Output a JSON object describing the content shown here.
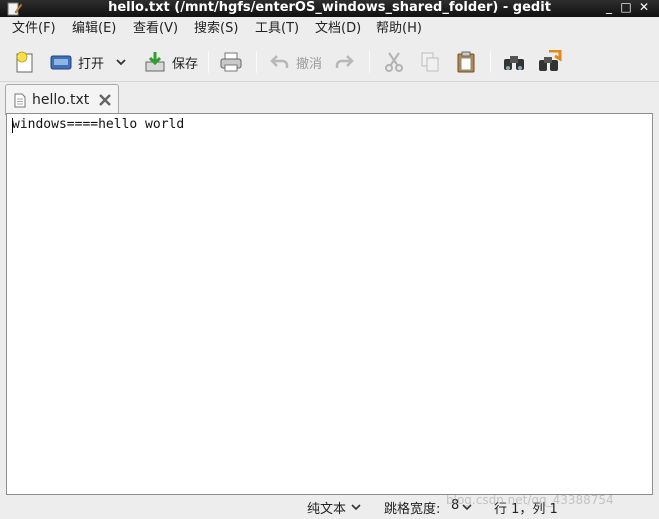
{
  "window": {
    "title": "hello.txt (/mnt/hgfs/enterOS_windows_shared_folder) - gedit",
    "minimize": "_",
    "maximize": "□",
    "close": "✕"
  },
  "menu": {
    "items": [
      "文件(F)",
      "编辑(E)",
      "查看(V)",
      "搜索(S)",
      "工具(T)",
      "文档(D)",
      "帮助(H)"
    ]
  },
  "toolbar": {
    "open_label": "打开",
    "save_label": "保存",
    "undo_label": "撤消"
  },
  "tab": {
    "filename": "hello.txt"
  },
  "editor": {
    "content": "windows====hello world"
  },
  "statusbar": {
    "language": "纯文本",
    "tab_width_label": "跳格宽度:",
    "tab_width_value": "8",
    "position": "行 1，列 1"
  },
  "watermark": "blog.csdn.net/qq_43388754",
  "colors": {
    "titlebar": "#1c1c1c",
    "editor_bg": "#ffffff",
    "chrome_bg": "#ededed"
  }
}
